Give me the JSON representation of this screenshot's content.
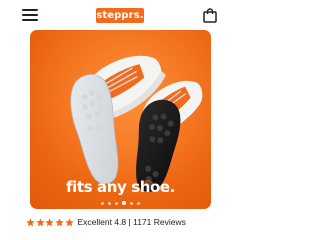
{
  "header": {
    "logo_text": "stepprs.",
    "brand_color": "#f26b1d",
    "menu_icon": "hamburger-menu-icon",
    "cart_icon": "shopping-bag-icon"
  },
  "hero": {
    "caption": "fits any shoe.",
    "background_color": "#ef6712",
    "carousel": {
      "total_slides": 6,
      "active_slide": 4
    }
  },
  "rating": {
    "stars": 5,
    "star_color": "#f26b1d",
    "label": "Excellent",
    "score": "4.8",
    "separator": "|",
    "review_count": "1171 Reviews"
  }
}
